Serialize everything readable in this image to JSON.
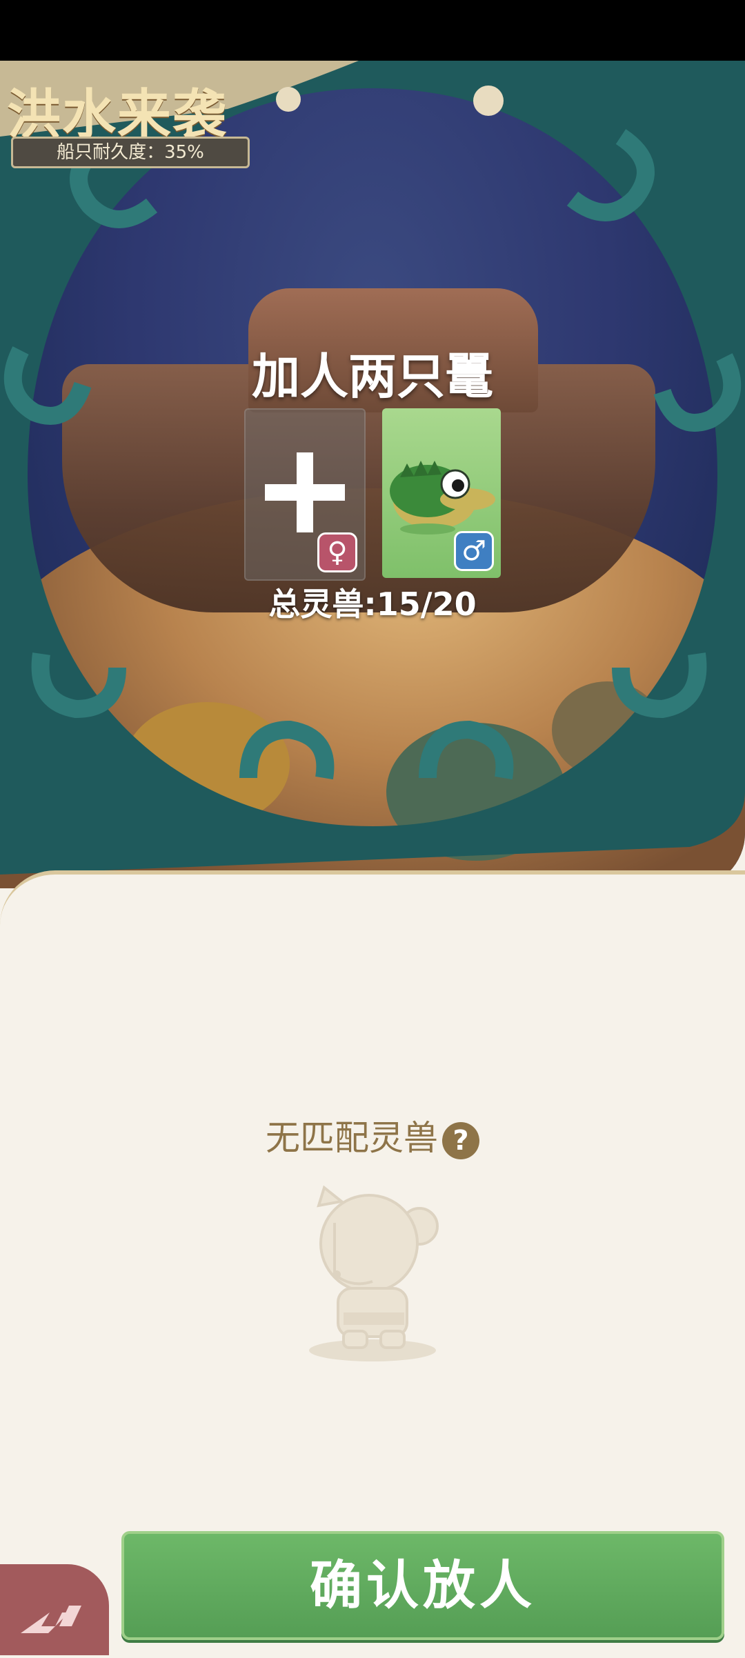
{
  "header": {
    "title": "洪水来袭",
    "durability": "船只耐久度：35%"
  },
  "pair": {
    "title": "加人两只鼍",
    "empty_slot_gender": "♀",
    "filled_slot_gender": "♂",
    "total": "总灵兽:15/20"
  },
  "list": {
    "empty_text": "无匹配灵兽",
    "help_glyph": "?"
  },
  "footer": {
    "confirm_label": "确认放人"
  },
  "colors": {
    "accent_green": "#5ea85b",
    "teal": "#1f5a5c",
    "gold": "#8e7448",
    "female": "#b8546a",
    "male": "#3f7fc2"
  }
}
